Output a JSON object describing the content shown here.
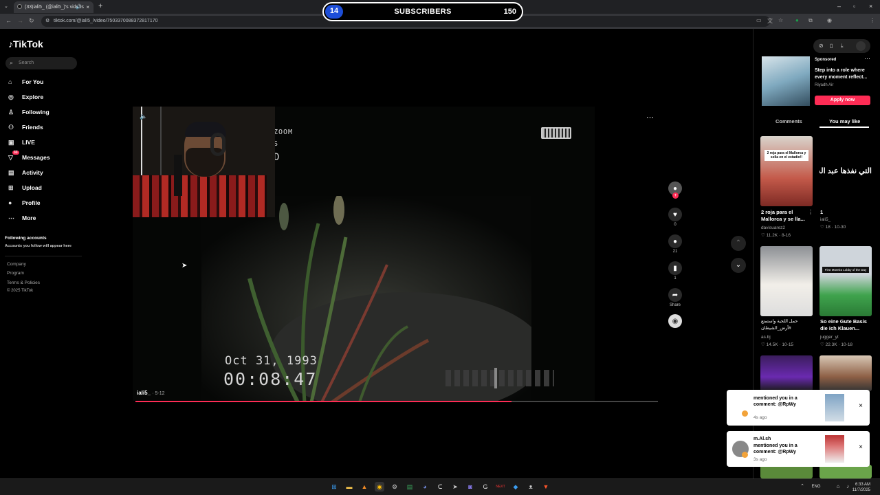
{
  "browser": {
    "tab_title": "(33)iali5_ (@iali5_)'s videos",
    "url": "tiktok.com/@iali5_/video/7503370088372817170"
  },
  "overlay": {
    "left_count": "14",
    "label": "SUBSCRIBERS",
    "right_count": "150"
  },
  "sidebar": {
    "logo": "TikTok",
    "search_placeholder": "Search",
    "nav": [
      {
        "label": "For You",
        "icon": "home-icon"
      },
      {
        "label": "Explore",
        "icon": "compass-icon"
      },
      {
        "label": "Following",
        "icon": "user-follow-icon"
      },
      {
        "label": "Friends",
        "icon": "friends-icon"
      },
      {
        "label": "LIVE",
        "icon": "live-icon"
      },
      {
        "label": "Messages",
        "icon": "messages-icon",
        "badge": "33"
      },
      {
        "label": "Activity",
        "icon": "activity-icon"
      },
      {
        "label": "Upload",
        "icon": "upload-icon"
      },
      {
        "label": "Profile",
        "icon": "profile-icon"
      },
      {
        "label": "More",
        "icon": "more-icon"
      }
    ],
    "following_title": "Following accounts",
    "following_sub": "Accounts you follow will appear here",
    "footer": [
      "Company",
      "Program",
      "Terms & Policies",
      "© 2025 TikTok"
    ]
  },
  "video": {
    "vhs_mode": "ZOOM",
    "vhs_s": "S",
    "vhs_d": "D",
    "date": "Oct 31, 1993",
    "time": "00:08:47",
    "author": "iali5_",
    "post_date": "· 5-12",
    "progress": 0.72
  },
  "actions": {
    "likes": "0",
    "comments": "21",
    "saves": "1",
    "share": "Share"
  },
  "right_panel": {
    "sponsored": "Sponsored",
    "ad_title": "Step into a role where every moment reflect...",
    "ad_brand": "Riyadh Air",
    "ad_button": "Apply now",
    "tab_comments": "Comments",
    "tab_you_may_like": "You may like",
    "cards": [
      {
        "title": "2 roja para el Mallorca y se lla...",
        "user": "davisuarez2",
        "likes": "11.2K",
        "date": "8-16",
        "thumb_text": "2 roja para el Mallorca y sella en el estadio!!"
      },
      {
        "title": "1",
        "user": "iali5_",
        "likes": "18",
        "date": "10-30",
        "thumb_text": "التي نفذها عبد الد"
      },
      {
        "title": "حمل اللحية واستمتع #أرض_الشيطان",
        "user": "as.bj",
        "likes": "14.5K",
        "date": "10-15"
      },
      {
        "title": "So eine Gute Basis die ich Klauen...",
        "user": "jugger_yt",
        "likes": "22.3K",
        "date": "10-18",
        "thumb_text": "First Moreira Lobby of the Day"
      }
    ]
  },
  "notifications": [
    {
      "name": "",
      "text": "mentioned you in a comment: @RpWy",
      "time": "4s ago"
    },
    {
      "name": "m.Al.sh",
      "text": "mentioned you in a comment: @RpWy",
      "time": "3s ago"
    }
  ],
  "taskbar": {
    "lang": "ENG",
    "time": "6:33 AM",
    "date": "11/7/2025"
  }
}
